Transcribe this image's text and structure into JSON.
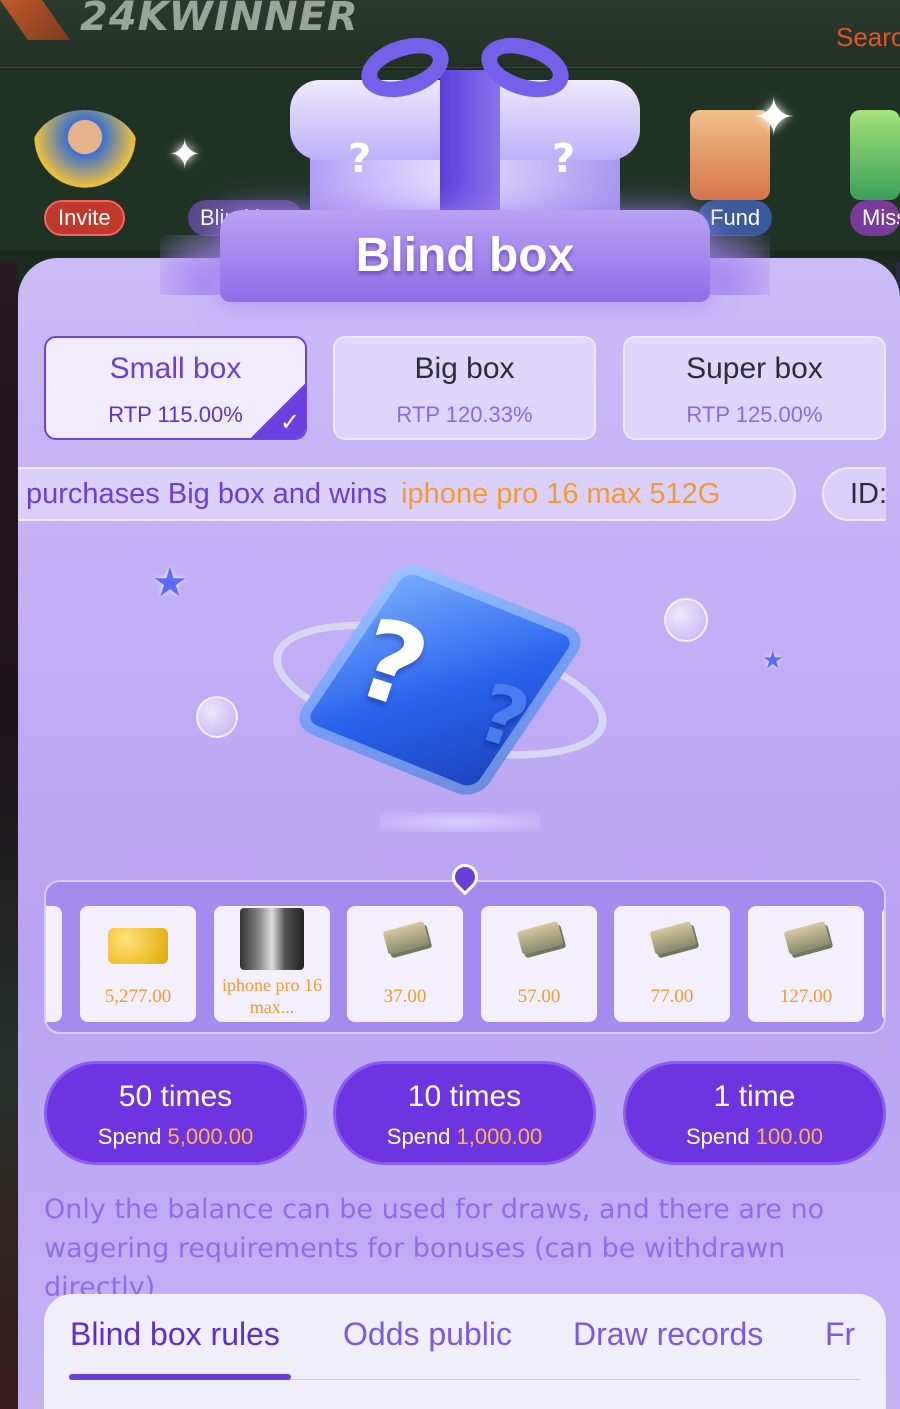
{
  "background_app": {
    "logo": "24KWINNER",
    "search_label": "Search",
    "shortcuts": [
      "Invite",
      "Blind box",
      "Fund",
      "Mission"
    ]
  },
  "modal": {
    "title": "Blind box",
    "box_tabs": [
      {
        "name": "Small box",
        "rtp": "RTP 115.00%",
        "selected": true
      },
      {
        "name": "Big box",
        "rtp": "RTP 120.33%",
        "selected": false
      },
      {
        "name": "Super box",
        "rtp": "RTP 125.00%",
        "selected": false
      }
    ],
    "marquee": {
      "text": "purchases Big box and wins",
      "prize": "iphone pro 16 max 512G",
      "id_label": "ID:"
    },
    "prizes": [
      {
        "value": "5,277.00",
        "icon": "gold-coins-icon"
      },
      {
        "value": "iphone pro 16 max...",
        "icon": "iphone-icon"
      },
      {
        "value": "37.00",
        "icon": "cash-stack-icon"
      },
      {
        "value": "57.00",
        "icon": "cash-stack-icon"
      },
      {
        "value": "77.00",
        "icon": "cash-stack-icon"
      },
      {
        "value": "127.00",
        "icon": "cash-stack-icon"
      }
    ],
    "draw_buttons": [
      {
        "times": "50 times",
        "spend_label": "Spend",
        "amount": "5,000.00"
      },
      {
        "times": "10 times",
        "spend_label": "Spend",
        "amount": "1,000.00"
      },
      {
        "times": "1 time",
        "spend_label": "Spend",
        "amount": "100.00"
      }
    ],
    "notice": "Only the balance can be used for draws, and there are no wagering requirements for bonuses (can be withdrawn directly)",
    "bottom_tabs": [
      {
        "label": "Blind box rules",
        "active": true
      },
      {
        "label": "Odds public",
        "active": false
      },
      {
        "label": "Draw records",
        "active": false
      },
      {
        "label": "Fr",
        "active": false
      }
    ]
  },
  "colors": {
    "accent_purple": "#6e34e0",
    "prize_orange": "#f39a2c",
    "amount_gold": "#ffb646"
  }
}
